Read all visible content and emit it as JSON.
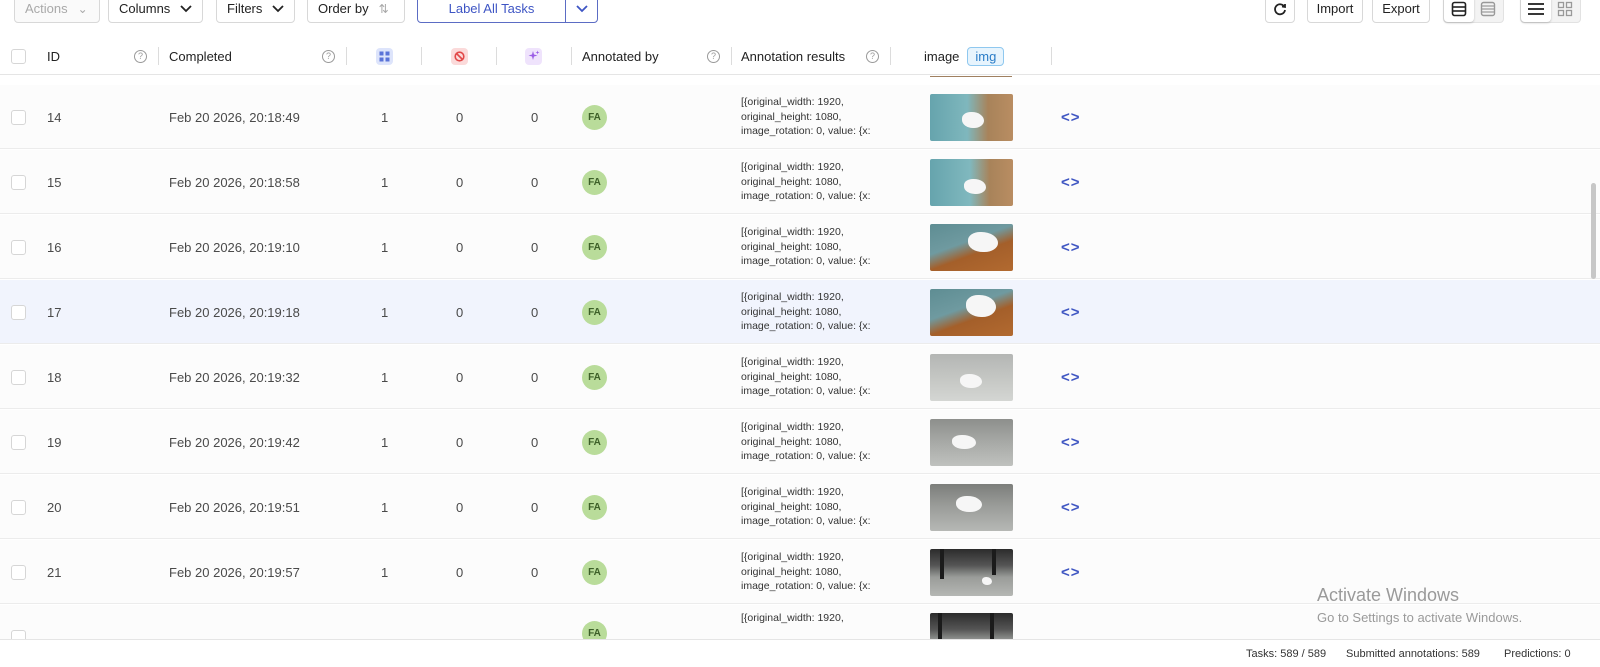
{
  "toolbar": {
    "actions_label": "Actions",
    "columns_label": "Columns",
    "filters_label": "Filters",
    "order_by_label": "Order by",
    "label_all_label": "Label All Tasks",
    "import_label": "Import",
    "export_label": "Export"
  },
  "columns": {
    "id": "ID",
    "completed": "Completed",
    "annotated_by": "Annotated by",
    "annotation_results": "Annotation results",
    "image": "image",
    "image_badge": "img"
  },
  "colors": {
    "accent": "#3e55c4",
    "avatar": "#b9dc9a",
    "row_highlight": "#f1f4fd"
  },
  "rows": [
    {
      "id": "14",
      "completed": "Feb 20 2026, 20:18:49",
      "total": "1",
      "cancelled": "0",
      "predictions": "0",
      "annotator": "FA",
      "result_l1": "[{original_width: 1920,",
      "result_l2": "original_height: 1080,",
      "result_l3": "image_rotation: 0, value: {x:"
    },
    {
      "id": "15",
      "completed": "Feb 20 2026, 20:18:58",
      "total": "1",
      "cancelled": "0",
      "predictions": "0",
      "annotator": "FA",
      "result_l1": "[{original_width: 1920,",
      "result_l2": "original_height: 1080,",
      "result_l3": "image_rotation: 0, value: {x:"
    },
    {
      "id": "16",
      "completed": "Feb 20 2026, 20:19:10",
      "total": "1",
      "cancelled": "0",
      "predictions": "0",
      "annotator": "FA",
      "result_l1": "[{original_width: 1920,",
      "result_l2": "original_height: 1080,",
      "result_l3": "image_rotation: 0, value: {x:"
    },
    {
      "id": "17",
      "completed": "Feb 20 2026, 20:19:18",
      "total": "1",
      "cancelled": "0",
      "predictions": "0",
      "annotator": "FA",
      "result_l1": "[{original_width: 1920,",
      "result_l2": "original_height: 1080,",
      "result_l3": "image_rotation: 0, value: {x:"
    },
    {
      "id": "18",
      "completed": "Feb 20 2026, 20:19:32",
      "total": "1",
      "cancelled": "0",
      "predictions": "0",
      "annotator": "FA",
      "result_l1": "[{original_width: 1920,",
      "result_l2": "original_height: 1080,",
      "result_l3": "image_rotation: 0, value: {x:"
    },
    {
      "id": "19",
      "completed": "Feb 20 2026, 20:19:42",
      "total": "1",
      "cancelled": "0",
      "predictions": "0",
      "annotator": "FA",
      "result_l1": "[{original_width: 1920,",
      "result_l2": "original_height: 1080,",
      "result_l3": "image_rotation: 0, value: {x:"
    },
    {
      "id": "20",
      "completed": "Feb 20 2026, 20:19:51",
      "total": "1",
      "cancelled": "0",
      "predictions": "0",
      "annotator": "FA",
      "result_l1": "[{original_width: 1920,",
      "result_l2": "original_height: 1080,",
      "result_l3": "image_rotation: 0, value: {x:"
    },
    {
      "id": "21",
      "completed": "Feb 20 2026, 20:19:57",
      "total": "1",
      "cancelled": "0",
      "predictions": "0",
      "annotator": "FA",
      "result_l1": "[{original_width: 1920,",
      "result_l2": "original_height: 1080,",
      "result_l3": "image_rotation: 0, value: {x:"
    },
    {
      "id": "",
      "completed": "",
      "total": "",
      "cancelled": "",
      "predictions": "",
      "annotator": "FA",
      "result_l1": "[{original_width: 1920,",
      "result_l2": "",
      "result_l3": ""
    }
  ],
  "footer": {
    "tasks": "Tasks: 589 / 589",
    "submitted": "Submitted annotations: 589",
    "predictions": "Predictions: 0"
  },
  "watermark": {
    "title": "Activate Windows",
    "subtitle": "Go to Settings to activate Windows."
  }
}
